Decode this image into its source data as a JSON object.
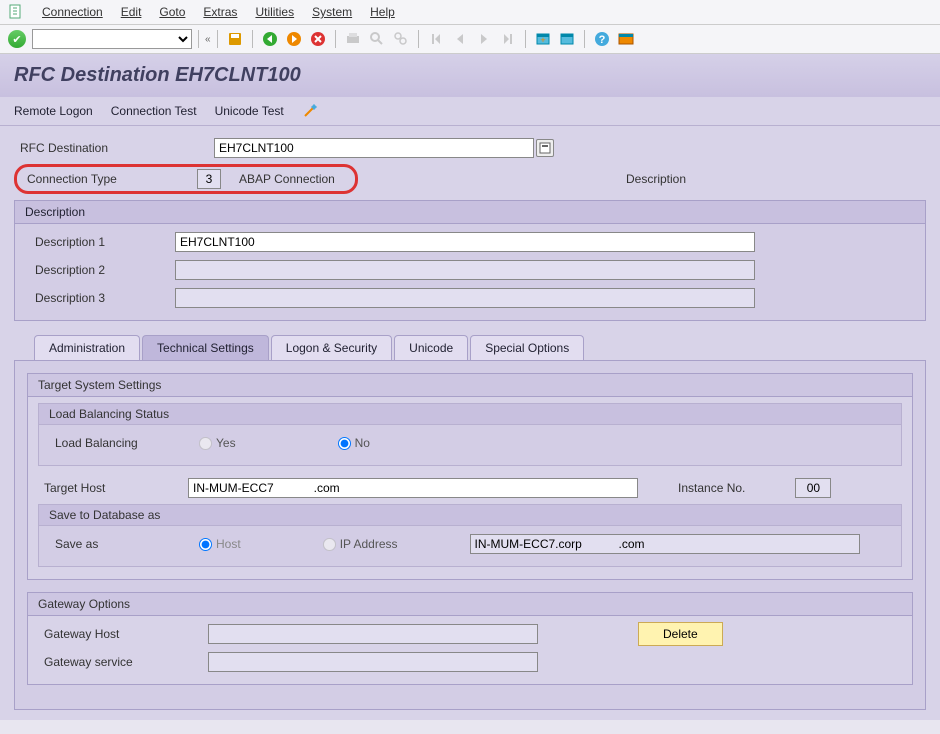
{
  "menu": {
    "items": [
      "Connection",
      "Edit",
      "Goto",
      "Extras",
      "Utilities",
      "System",
      "Help"
    ]
  },
  "title": "RFC Destination EH7CLNT100",
  "actions": {
    "remote_logon": "Remote Logon",
    "connection_test": "Connection Test",
    "unicode_test": "Unicode Test"
  },
  "header": {
    "rfc_destination_label": "RFC Destination",
    "rfc_destination_value": "EH7CLNT100",
    "connection_type_label": "Connection Type",
    "connection_type_code": "3",
    "connection_type_text": "ABAP Connection",
    "description_label": "Description"
  },
  "description": {
    "group_title": "Description",
    "desc1_label": "Description 1",
    "desc1_value": "EH7CLNT100",
    "desc2_label": "Description 2",
    "desc2_value": "",
    "desc3_label": "Description 3",
    "desc3_value": ""
  },
  "tabs": {
    "administration": "Administration",
    "technical": "Technical Settings",
    "logon": "Logon & Security",
    "unicode": "Unicode",
    "special": "Special Options"
  },
  "technical": {
    "target_system_title": "Target System Settings",
    "load_balancing_status_title": "Load Balancing Status",
    "load_balancing_label": "Load Balancing",
    "yes": "Yes",
    "no": "No",
    "target_host_label": "Target Host",
    "target_host_value": "IN-MUM-ECC7            .com",
    "instance_no_label": "Instance No.",
    "instance_no_value": "00",
    "save_db_title": "Save to Database as",
    "save_as_label": "Save as",
    "host_option": "Host",
    "ip_option": "IP Address",
    "save_as_value": "IN-MUM-ECC7.corp           .com",
    "gateway_title": "Gateway Options",
    "gateway_host_label": "Gateway Host",
    "gateway_host_value": "",
    "gateway_service_label": "Gateway service",
    "gateway_service_value": "",
    "delete_btn": "Delete"
  }
}
